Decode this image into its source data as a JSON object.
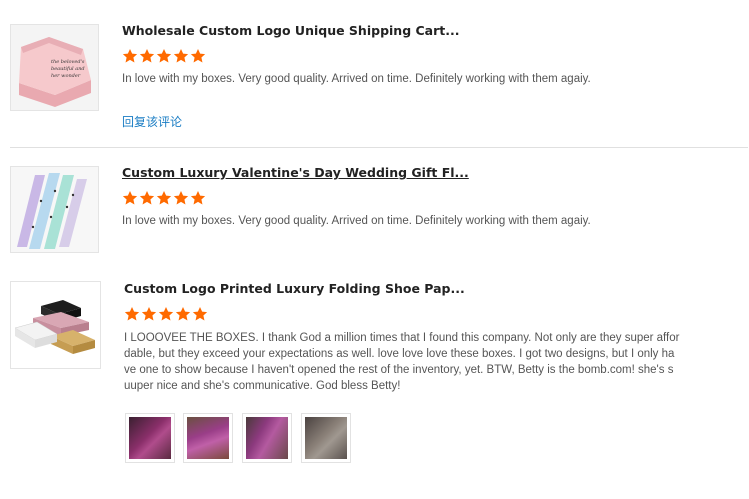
{
  "reviews": [
    {
      "title": "Wholesale Custom Logo Unique Shipping Cart...",
      "rating": 5,
      "text": "In love with my boxes. Very good quality. Arrived on time. Definitely working with them agaiy.",
      "reply_label": "回复该评论",
      "thumb_icon": "pink-shipping-box-image"
    },
    {
      "title": "Custom Luxury Valentine's Day Wedding Gift Fl...",
      "rating": 5,
      "text": "In love with my boxes. Very good quality. Arrived on time. Definitely working with them agaiy.",
      "thumb_icon": "gift-wrapping-paper-image"
    },
    {
      "title": "Custom Logo Printed Luxury Folding Shoe Pap...",
      "rating": 5,
      "text_lines": [
        "I LOOOVEE THE BOXES. I thank God a million times that I found this company. Not only are they super affor",
        "dable, but they exceed your expectations as well. love love love these boxes. I got two designs, but I only ha",
        "ve one to show because I haven't opened the rest of the inventory, yet. BTW, Betty is the bomb.com! she's s",
        "uuper nice and she's communicative. God bless Betty!"
      ],
      "thumb_icon": "folding-shoe-boxes-image",
      "photos": [
        "purple-box-photo-1",
        "purple-box-photo-2",
        "purple-box-photo-3",
        "grey-box-photo-4"
      ]
    }
  ],
  "colors": {
    "star": "#ff6a00",
    "reply_link": "#1a7dc4"
  }
}
